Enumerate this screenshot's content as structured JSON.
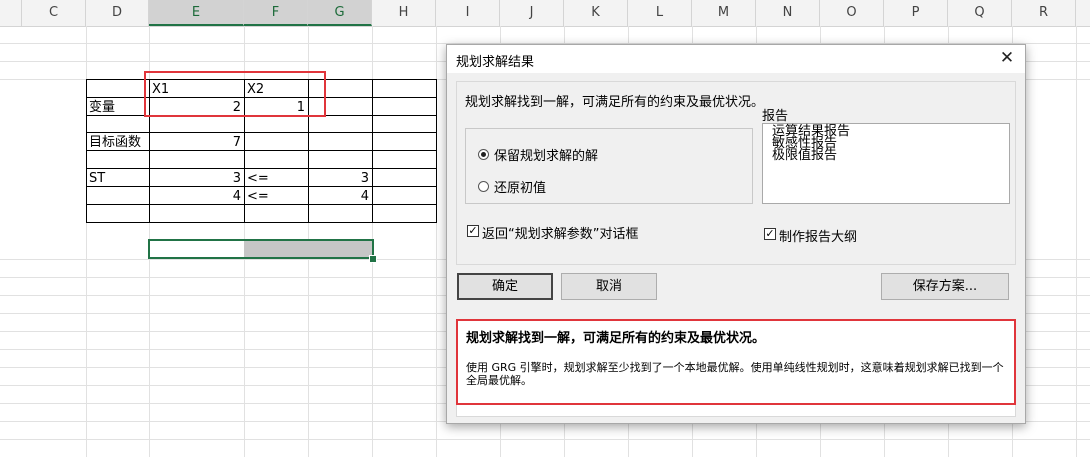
{
  "sheet": {
    "columns": [
      "C",
      "D",
      "E",
      "F",
      "G",
      "H",
      "I",
      "J",
      "K",
      "L",
      "M",
      "N",
      "O",
      "P",
      "Q",
      "R"
    ],
    "selected_columns": [
      "E",
      "F",
      "G"
    ],
    "cells": {
      "E_header": "X1",
      "F_header": "X2",
      "D_var": "变量",
      "E_var": "2",
      "F_var": "1",
      "D_obj": "目标函数",
      "E_obj": "7",
      "D_st": "ST",
      "E_st1": "3",
      "F_st1": "<=",
      "G_st1": "3",
      "E_st2": "4",
      "F_st2": "<=",
      "G_st2": "4"
    }
  },
  "dialog": {
    "title": "规划求解结果",
    "found_message": "规划求解找到一解，可满足所有的约束及最优状况。",
    "radio_keep": "保留规划求解的解",
    "radio_restore": "还原初值",
    "report_label": "报告",
    "reports": [
      "运算结果报告",
      "敏感性报告",
      "极限值报告"
    ],
    "check_return": "返回“规划求解参数”对话框",
    "check_outline": "制作报告大纲",
    "btn_ok": "确定",
    "btn_cancel": "取消",
    "btn_save": "保存方案...",
    "detail_title": "规划求解找到一解，可满足所有的约束及最优状况。",
    "detail_body": "使用 GRG 引擎时，规划求解至少找到了一个本地最优解。使用单纯线性规划时，这意味着规划求解已找到一个全局最优解。"
  },
  "colors": {
    "highlight_red": "#e0353b",
    "excel_green": "#217346"
  }
}
